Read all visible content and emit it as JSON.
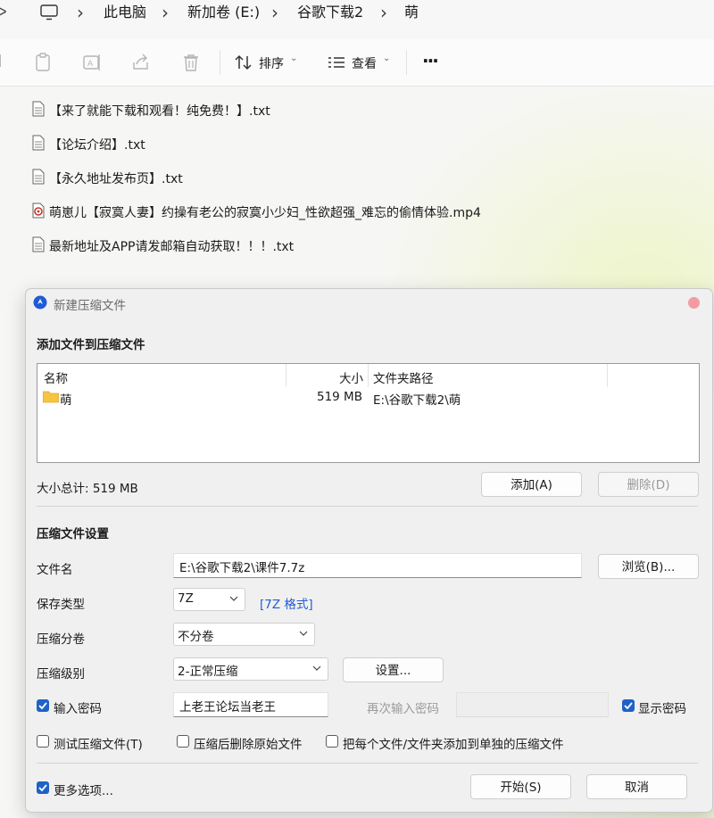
{
  "breadcrumb": {
    "items": [
      "此电脑",
      "新加卷 (E:)",
      "谷歌下载2",
      "萌"
    ]
  },
  "toolbar": {
    "sort_label": "排序",
    "view_label": "查看",
    "more_label": "···"
  },
  "files": [
    {
      "name": "【来了就能下载和观看！纯免费！】.txt",
      "type": "txt"
    },
    {
      "name": "【论坛介绍】.txt",
      "type": "txt"
    },
    {
      "name": "【永久地址发布页】.txt",
      "type": "txt"
    },
    {
      "name": "萌崽儿【寂寞人妻】约操有老公的寂寞小少妇_性欲超强_难忘的偷情体验.mp4",
      "type": "mp4"
    },
    {
      "name": "最新地址及APP请发邮箱自动获取！！！.txt",
      "type": "txt"
    }
  ],
  "dialog": {
    "title": "新建压缩文件",
    "add_section_title": "添加文件到压缩文件",
    "columns": {
      "name": "名称",
      "size": "大小",
      "path": "文件夹路径"
    },
    "rows": [
      {
        "name": "萌",
        "size": "519 MB",
        "path": "E:\\谷歌下载2\\萌"
      }
    ],
    "total_size": "大小总计: 519 MB",
    "add_button": "添加(A)",
    "delete_button": "删除(D)",
    "settings_title": "压缩文件设置",
    "filename_label": "文件名",
    "filename_value": "E:\\谷歌下载2\\课件7.7z",
    "browse_button": "浏览(B)...",
    "save_type_label": "保存类型",
    "save_type_value": "7Z",
    "format_link": "[7Z 格式]",
    "split_label": "压缩分卷",
    "split_value": "不分卷",
    "level_label": "压缩级别",
    "level_value": "2-正常压缩",
    "settings_button": "设置...",
    "password_label": "输入密码",
    "password_value": "上老王论坛当老王",
    "password_checked": true,
    "reenter_label": "再次输入密码",
    "reenter_value": "",
    "show_password_label": "显示密码",
    "show_password_checked": true,
    "test_label": "测试压缩文件(T)",
    "test_checked": false,
    "delete_after_label": "压缩后删除原始文件",
    "delete_after_checked": false,
    "separate_label": "把每个文件/文件夹添加到单独的压缩文件",
    "separate_checked": false,
    "more_options_label": "更多选项...",
    "more_options_checked": true,
    "start_button": "开始(S)",
    "cancel_button": "取消"
  },
  "colors": {
    "accent": "#1f62c6",
    "link": "#1f5bd6",
    "close_dot": "#f29ca1"
  }
}
